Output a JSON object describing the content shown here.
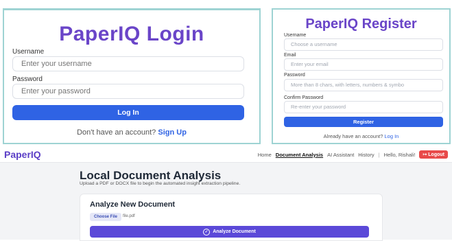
{
  "login": {
    "title": "PaperIQ Login",
    "username_label": "Username",
    "username_placeholder": "Enter your username",
    "password_label": "Password",
    "password_placeholder": "Enter your password",
    "button": "Log In",
    "footer_text": "Don't have an account?",
    "footer_link": "Sign Up"
  },
  "register": {
    "title": "PaperIQ Register",
    "username_label": "Username",
    "username_placeholder": "Choose a username",
    "email_label": "Email",
    "email_placeholder": "Enter your email",
    "password_label": "Password",
    "password_placeholder": "More than 8 chars, with letters, numbers & symbo",
    "confirm_label": "Confirm Password",
    "confirm_placeholder": "Re-enter your password",
    "button": "Register",
    "footer_text": "Already have an account?",
    "footer_link": "Log In"
  },
  "app": {
    "brand": "PaperIQ",
    "nav": {
      "home": "Home",
      "document_analysis": "Document Analysis",
      "ai_assistant": "AI Assistant",
      "history": "History",
      "separator": "|",
      "greeting": "Hello, Rishali!",
      "logout": "Logout"
    },
    "page_title": "Local Document Analysis",
    "page_subtitle": "Upload a PDF or DOCX file to begin the automated insight extraction pipeline.",
    "card": {
      "title": "Analyze New Document",
      "choose_file": "Choose File",
      "file_name": "file.pdf",
      "analyze_button": "Analyze Document"
    }
  },
  "colors": {
    "brand_purple": "#6a45c8",
    "primary_blue": "#2f63e4",
    "analyze_purple": "#5b49d8",
    "logout_red": "#e84a4a",
    "panel_border": "#9ed3d3"
  }
}
